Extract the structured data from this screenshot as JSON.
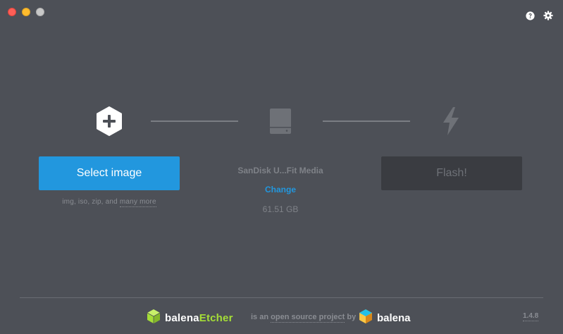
{
  "window": {
    "traffic_lights": [
      "close",
      "minimize",
      "zoom"
    ]
  },
  "toolbar": {
    "help_icon": "help-icon",
    "settings_icon": "gear-icon"
  },
  "steps": {
    "image": {
      "icon": "plus-hexagon-icon",
      "button_label": "Select image",
      "hint_formats": "img, iso, zip, and",
      "hint_more": "many more"
    },
    "drive": {
      "icon": "drive-icon",
      "name": "SanDisk U...Fit Media",
      "change_label": "Change",
      "size": "61.51 GB"
    },
    "flash": {
      "icon": "lightning-icon",
      "button_label": "Flash!"
    }
  },
  "footer": {
    "brand_base": "balena",
    "brand_accent": "Etcher",
    "tagline_prefix": "is an",
    "tagline_link": "open source project",
    "tagline_suffix": "by",
    "company": "balena",
    "version": "1.4.8"
  },
  "colors": {
    "background": "#4d5057",
    "primary": "#2297de",
    "accent_green": "#a5de37",
    "disabled_bg": "#3a3c41"
  }
}
